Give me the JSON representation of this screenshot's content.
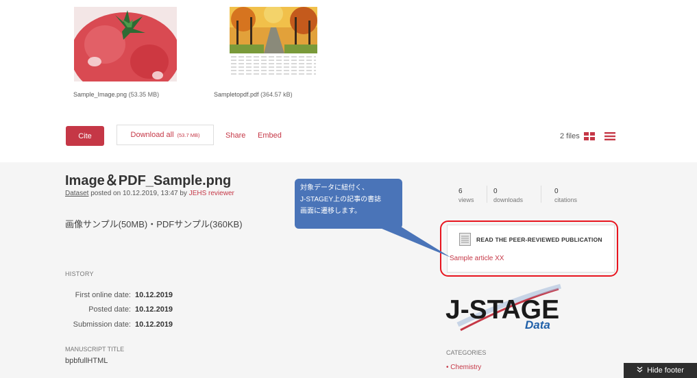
{
  "files": [
    {
      "name": "Sample_Image.png",
      "size": "(53.35 MB)"
    },
    {
      "name": "Sampletopdf.pdf",
      "size": "(364.57 kB)"
    }
  ],
  "toolbar": {
    "cite_label": "Cite",
    "download_label": "Download all",
    "download_size": "(53.7 MB)",
    "share_label": "Share",
    "embed_label": "Embed",
    "files_count": "2 files"
  },
  "item": {
    "title": "Image＆PDF_Sample.png",
    "type_label": "Dataset",
    "posted_text": " posted on 10.12.2019, 13:47 by ",
    "author": "JEHS reviewer",
    "description": "画像サンプル(50MB)・PDFサンプル(360KB)"
  },
  "history": {
    "label": "HISTORY",
    "rows": [
      {
        "key": "First online date:",
        "value": "10.12.2019"
      },
      {
        "key": "Posted date:",
        "value": "10.12.2019"
      },
      {
        "key": "Submission date:",
        "value": "10.12.2019"
      }
    ]
  },
  "manuscript": {
    "label": "MANUSCRIPT TITLE",
    "value": "bpbfullHTML"
  },
  "stats": [
    {
      "count": "6",
      "label": "views"
    },
    {
      "count": "0",
      "label": "downloads"
    },
    {
      "count": "0",
      "label": "citations"
    }
  ],
  "callout": {
    "lines": [
      "対象データに紐付く、",
      "J-STAGEY上の記事の書誌",
      "画面に遷移します。"
    ]
  },
  "publication": {
    "heading": "READ THE PEER-REVIEWED PUBLICATION",
    "link": "Sample article XX"
  },
  "logo": {
    "main": "J-STAGE",
    "sub": "Data"
  },
  "categories": {
    "label": "CATEGORIES",
    "items": [
      "Chemistry"
    ]
  },
  "footer": {
    "hide_label": "Hide footer"
  },
  "colors": {
    "accent": "#c53746",
    "callout": "#4a74b8",
    "highlight": "#e8141e",
    "logo_blue": "#1f5fa8"
  }
}
